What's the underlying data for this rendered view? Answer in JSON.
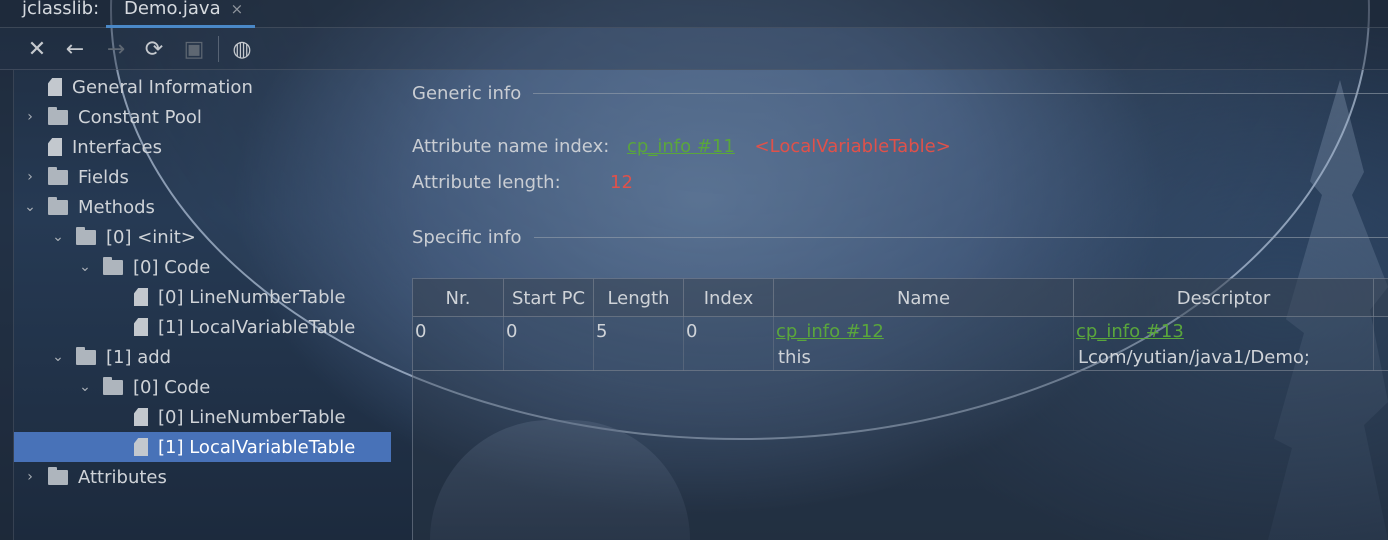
{
  "window": {
    "app_label": "jclasslib:",
    "tab_label": "Demo.java",
    "tab_close": "×"
  },
  "toolbar": {
    "close": "✕",
    "back": "←",
    "forward": "→",
    "refresh": "⟳",
    "save": "▣",
    "web": "◍"
  },
  "tree": {
    "general_information": "General Information",
    "constant_pool": "Constant Pool",
    "interfaces": "Interfaces",
    "fields": "Fields",
    "methods": "Methods",
    "method_init": "[0] <init>",
    "init_code": "[0] Code",
    "init_lnt": "[0] LineNumberTable",
    "init_lvt": "[1] LocalVariableTable",
    "method_add": "[1] add",
    "add_code": "[0] Code",
    "add_lnt": "[0] LineNumberTable",
    "add_lvt": "[1] LocalVariableTable",
    "attributes": "Attributes",
    "chevron_right": "›",
    "chevron_down": "⌄"
  },
  "generic_info": {
    "title": "Generic info",
    "name_index_label": "Attribute name index:",
    "name_index_link": "cp_info #11",
    "name_index_value": "<LocalVariableTable>",
    "length_label": "Attribute length:",
    "length_value": "12"
  },
  "specific_info": {
    "title": "Specific info",
    "columns": [
      "Nr.",
      "Start PC",
      "Length",
      "Index",
      "Name",
      "Descriptor"
    ],
    "rows": [
      {
        "nr": "0",
        "start_pc": "0",
        "length": "5",
        "index": "0",
        "name_link": "cp_info #12",
        "name_value": "this",
        "descriptor_link": "cp_info #13",
        "descriptor_value": "Lcom/yutian/java1/Demo;"
      }
    ]
  }
}
